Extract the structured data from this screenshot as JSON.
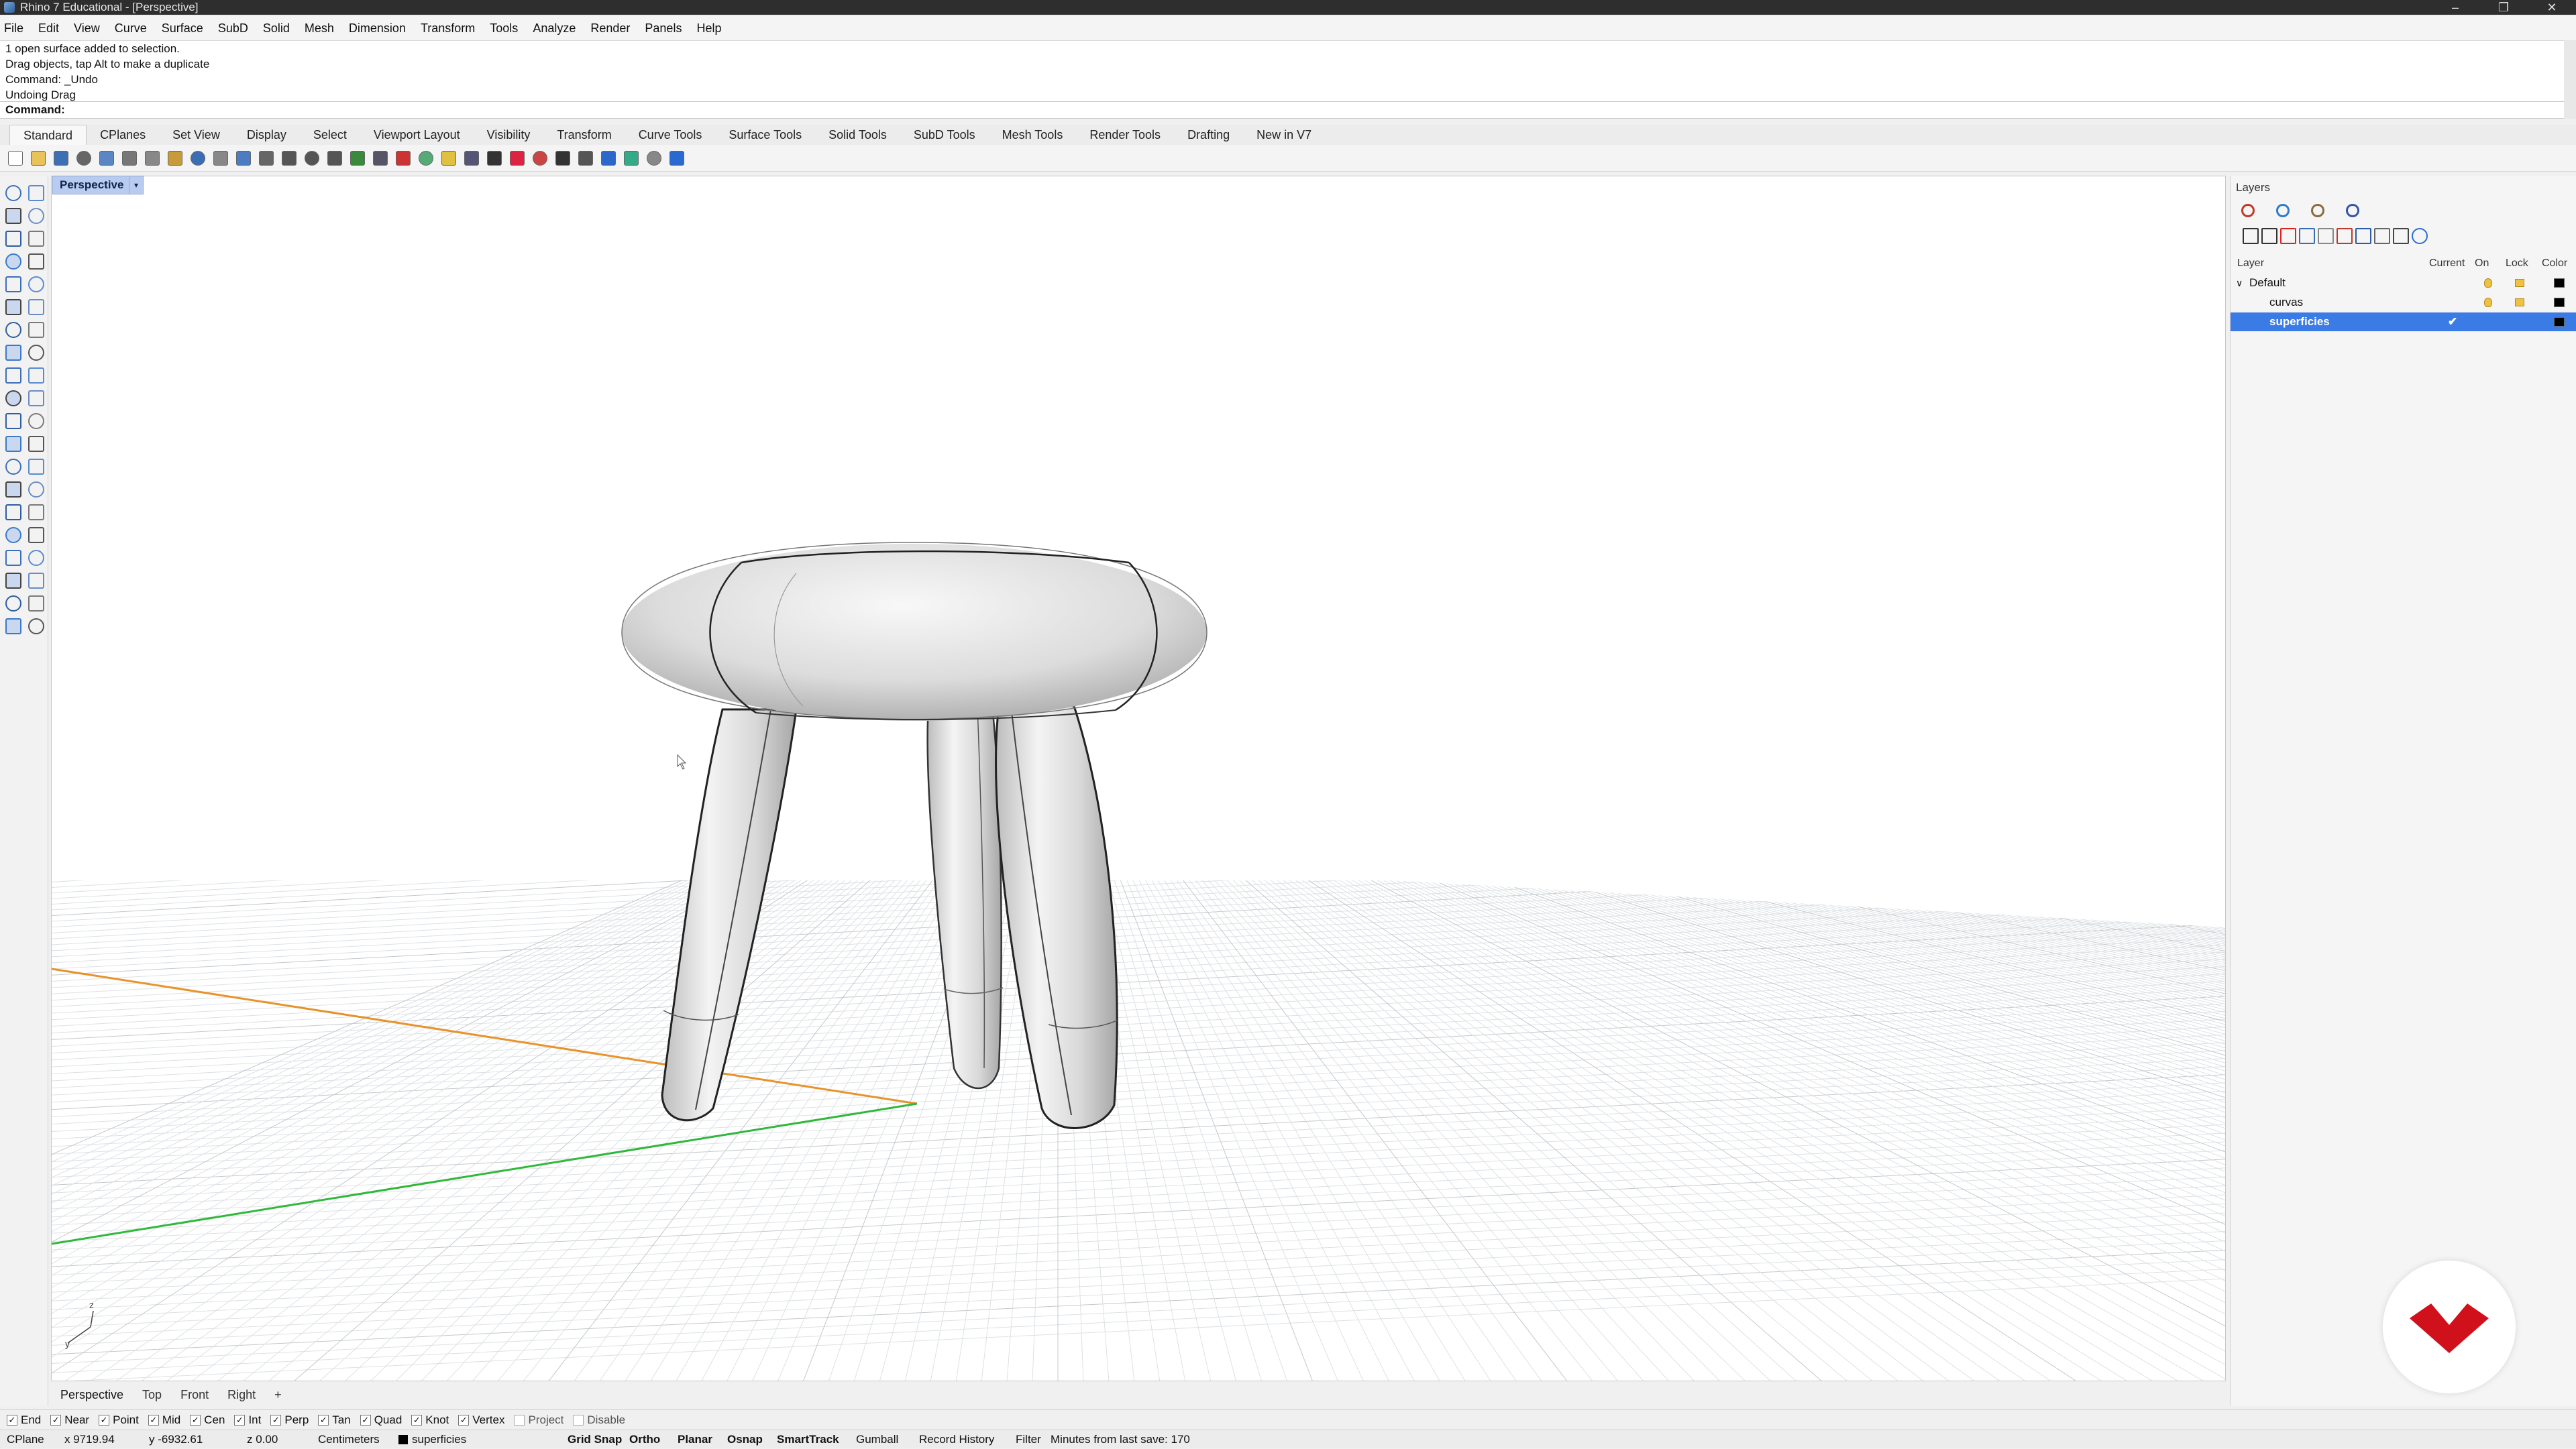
{
  "window": {
    "title": "Rhino 7 Educational - [Perspective]",
    "controls": [
      "–",
      "❐",
      "✕"
    ]
  },
  "menu": [
    "File",
    "Edit",
    "View",
    "Curve",
    "Surface",
    "SubD",
    "Solid",
    "Mesh",
    "Dimension",
    "Transform",
    "Tools",
    "Analyze",
    "Render",
    "Panels",
    "Help"
  ],
  "command_history": [
    "1 open surface added to selection.",
    "Drag objects, tap Alt to make a duplicate",
    "Command: _Undo",
    "Undoing Drag"
  ],
  "command_prompt": "Command:",
  "toolbar_tabs": [
    "Standard",
    "CPlanes",
    "Set View",
    "Display",
    "Select",
    "Viewport Layout",
    "Visibility",
    "Transform",
    "Curve Tools",
    "Surface Tools",
    "Solid Tools",
    "SubD Tools",
    "Mesh Tools",
    "Render Tools",
    "Drafting",
    "New in V7"
  ],
  "viewport": {
    "title": "Perspective",
    "axis_labels": {
      "z": "z",
      "y": "y"
    }
  },
  "viewport_tabs": [
    "Perspective",
    "Top",
    "Front",
    "Right",
    "+"
  ],
  "layers_panel": {
    "title": "Layers",
    "columns": [
      "Layer",
      "Current",
      "On",
      "Lock",
      "Color"
    ],
    "rows": [
      {
        "name": "Default",
        "expand": "∨",
        "current": "",
        "on": true,
        "lock": true,
        "color": "#000000",
        "selected": false,
        "indent": 0
      },
      {
        "name": "curvas",
        "expand": "",
        "current": "",
        "on": true,
        "lock": true,
        "color": "#000000",
        "selected": false,
        "indent": 1
      },
      {
        "name": "superficies",
        "expand": "",
        "current": "✔",
        "on": true,
        "lock": true,
        "color": "#000000",
        "selected": true,
        "indent": 1
      }
    ]
  },
  "osnaps": [
    {
      "label": "End",
      "checked": true
    },
    {
      "label": "Near",
      "checked": true
    },
    {
      "label": "Point",
      "checked": true
    },
    {
      "label": "Mid",
      "checked": true
    },
    {
      "label": "Cen",
      "checked": true
    },
    {
      "label": "Int",
      "checked": true
    },
    {
      "label": "Perp",
      "checked": true
    },
    {
      "label": "Tan",
      "checked": true
    },
    {
      "label": "Quad",
      "checked": true
    },
    {
      "label": "Knot",
      "checked": true
    },
    {
      "label": "Vertex",
      "checked": true
    },
    {
      "label": "Project",
      "checked": false
    },
    {
      "label": "Disable",
      "checked": false
    }
  ],
  "status": {
    "cplane": "CPlane",
    "x": "x 9719.94",
    "y": "y -6932.61",
    "z": "z 0.00",
    "units": "Centimeters",
    "layer": "superficies",
    "layer_color": "#000000",
    "toggles": [
      {
        "label": "Grid Snap",
        "on": true
      },
      {
        "label": "Ortho",
        "on": true
      },
      {
        "label": "Planar",
        "on": true
      },
      {
        "label": "Osnap",
        "on": true
      },
      {
        "label": "SmartTrack",
        "on": true
      },
      {
        "label": "Gumball",
        "on": false
      },
      {
        "label": "Record History",
        "on": false
      },
      {
        "label": "Filter",
        "on": false
      }
    ],
    "save_info": "Minutes from last save: 170"
  },
  "colors": {
    "accent": "#3b7be6",
    "x_axis": "#e8922a",
    "y_axis": "#2fb83a",
    "logo": "#d0101a"
  },
  "icons": {
    "toolbar": [
      "new-icon",
      "open-icon",
      "save-icon",
      "print-icon",
      "import-icon",
      "cut-icon",
      "copy-icon",
      "paste-icon",
      "undo-icon",
      "pan-icon",
      "rotate-view-icon",
      "zoom-icon",
      "zoom-window-icon",
      "zoom-extents-icon",
      "zoom-selected-icon",
      "rotate-icon",
      "grid-icon",
      "cplane-icon",
      "named-views-icon",
      "lights-icon",
      "display-mode-icon",
      "lock-icon",
      "color-icon",
      "rendered-icon",
      "shaded-icon",
      "materials-icon",
      "environment-icon",
      "render-icon",
      "options-icon",
      "help-icon"
    ],
    "left": [
      "select-icon",
      "point-icon",
      "polyline-icon",
      "curve-icon",
      "circle-icon",
      "arc-icon",
      "rectangle-icon",
      "polygon-icon",
      "ellipse-icon",
      "freeform-icon",
      "surface-icon",
      "loft-icon",
      "box-icon",
      "sphere-icon",
      "extrude-icon",
      "revolve-icon",
      "fillet-icon",
      "chamfer-icon",
      "move-icon",
      "copy-icon",
      "rotate-icon",
      "scale-icon",
      "mirror-icon",
      "array-icon",
      "join-icon",
      "explode-icon",
      "trim-icon",
      "split-icon",
      "text-icon",
      "dimension-icon",
      "grid-snap-icon",
      "ortho-icon",
      "mesh-icon",
      "subd-icon",
      "render-icon",
      "analyze-icon",
      "check-icon",
      "group-icon",
      "hide-icon",
      "lock-icon"
    ],
    "panel_tabs": [
      "layers-tab-icon",
      "materials-tab-icon",
      "properties-tab-icon",
      "display-tab-icon"
    ],
    "layer_tools": [
      "new-layer-icon",
      "new-sublayer-icon",
      "delete-layer-icon",
      "move-up-icon",
      "move-down-icon",
      "move-to-parent-icon",
      "filter-icon",
      "layer-options-icon",
      "tools-icon",
      "help-icon"
    ]
  }
}
